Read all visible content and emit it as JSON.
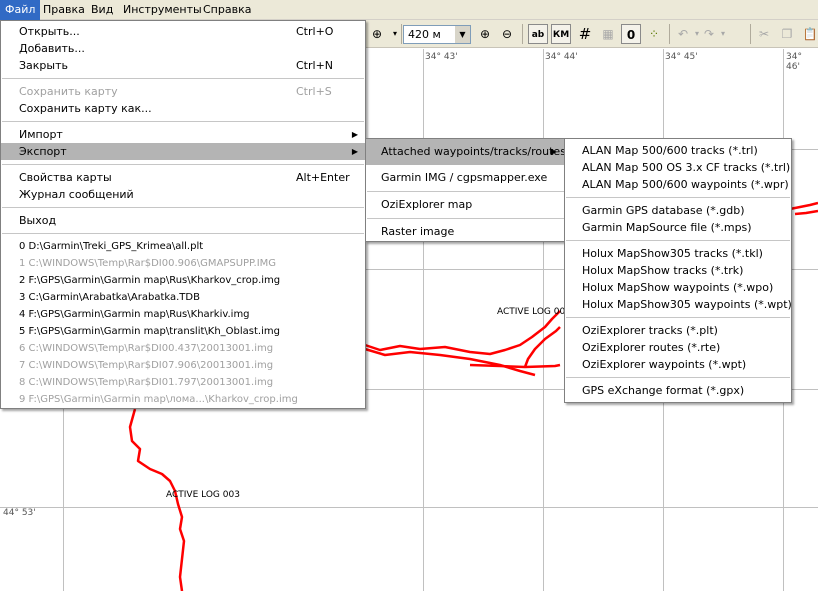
{
  "menubar": [
    "Файл",
    "Правка",
    "Вид",
    "Инструменты",
    "Справка"
  ],
  "toolbar": {
    "zoom_value": "420 м",
    "labels_button": "ab",
    "km_button": "КМ"
  },
  "map": {
    "lon_labels": [
      "34° 43'",
      "34° 44'",
      "34° 45'",
      "34° 46'"
    ],
    "lat_label": "44° 53'",
    "track_labels": [
      "ACTIVE LOG 003",
      "ACTIVE LOG 003"
    ]
  },
  "file_menu": {
    "open": {
      "label": "Открыть...",
      "shortcut": "Ctrl+O"
    },
    "add": {
      "label": "Добавить..."
    },
    "close": {
      "label": "Закрыть",
      "shortcut": "Ctrl+N"
    },
    "save": {
      "label": "Сохранить карту",
      "shortcut": "Ctrl+S"
    },
    "save_as": {
      "label": "Сохранить карту как..."
    },
    "import": {
      "label": "Импорт"
    },
    "export": {
      "label": "Экспорт"
    },
    "properties": {
      "label": "Свойства карты",
      "shortcut": "Alt+Enter"
    },
    "log": {
      "label": "Журнал сообщений"
    },
    "exit": {
      "label": "Выход"
    },
    "recent": [
      "0 D:\\Garmin\\Treki_GPS_Krimea\\all.plt",
      "1 C:\\WINDOWS\\Temp\\Rar$DI00.906\\GMAPSUPP.IMG",
      "2 F:\\GPS\\Garmin\\Garmin map\\Rus\\Kharkov_crop.img",
      "3 C:\\Garmin\\Arabatka\\Arabatka.TDB",
      "4 F:\\GPS\\Garmin\\Garmin map\\Rus\\Kharkiv.img",
      "5 F:\\GPS\\Garmin\\Garmin map\\translit\\Kh_Oblast.img",
      "6 C:\\WINDOWS\\Temp\\Rar$DI00.437\\20013001.img",
      "7 C:\\WINDOWS\\Temp\\Rar$DI07.906\\20013001.img",
      "8 C:\\WINDOWS\\Temp\\Rar$DI01.797\\20013001.img",
      "9 F:\\GPS\\Garmin\\Garmin map\\лома...\\Kharkov_crop.img"
    ]
  },
  "export_menu": {
    "attached": "Attached waypoints/tracks/routes",
    "garmin_img": "Garmin IMG / cgpsmapper.exe",
    "ozi_map": "OziExplorer map",
    "raster": "Raster image"
  },
  "formats_menu": {
    "items": [
      "ALAN Map 500/600 tracks (*.trl)",
      "ALAN Map 500 OS 3.x CF tracks (*.trl)",
      "ALAN Map 500/600 waypoints (*.wpr)",
      "Garmin GPS database (*.gdb)",
      "Garmin MapSource file (*.mps)",
      "Holux MapShow305 tracks (*.tkl)",
      "Holux MapShow tracks (*.trk)",
      "Holux MapShow waypoints (*.wpo)",
      "Holux MapShow305 waypoints (*.wpt)",
      "OziExplorer tracks (*.plt)",
      "OziExplorer routes (*.rte)",
      "OziExplorer waypoints (*.wpt)",
      "GPS eXchange format (*.gpx)"
    ]
  },
  "colors": {
    "track": "#ff0000",
    "menu_highlight": "#b4b4b4",
    "menubar_active": "#316ac5"
  }
}
